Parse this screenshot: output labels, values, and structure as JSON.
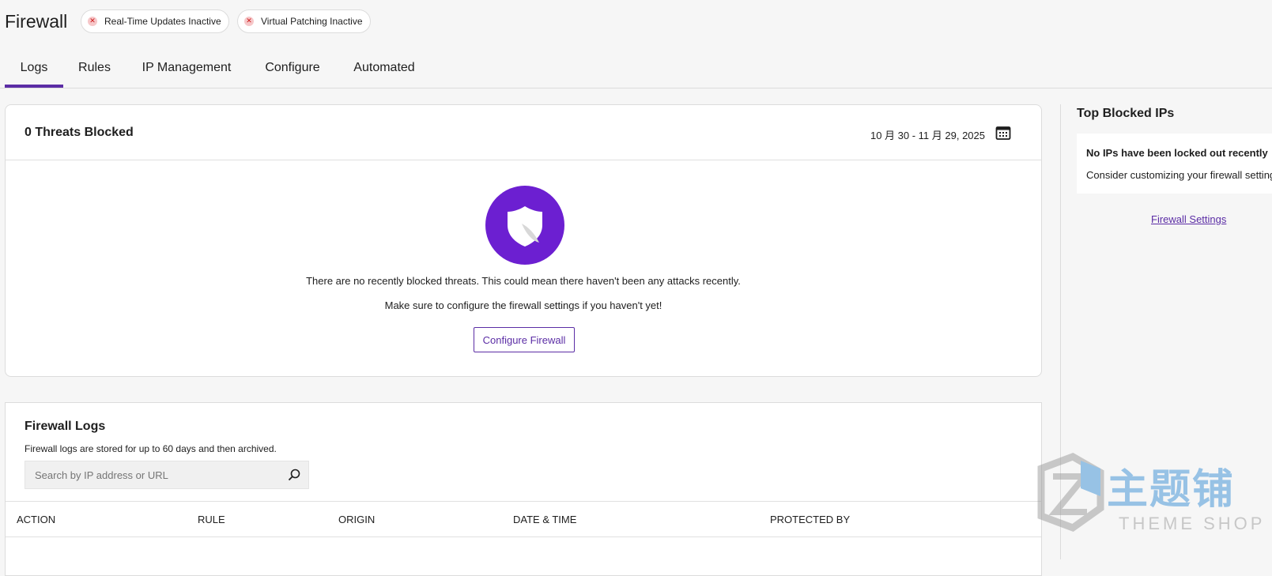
{
  "header": {
    "title": "Firewall",
    "badges": [
      {
        "label": "Real-Time Updates Inactive",
        "icon": "close-circle-icon"
      },
      {
        "label": "Virtual Patching Inactive",
        "icon": "close-circle-icon"
      }
    ]
  },
  "tabs": [
    {
      "label": "Logs",
      "active": true
    },
    {
      "label": "Rules",
      "active": false
    },
    {
      "label": "IP Management",
      "active": false
    },
    {
      "label": "Configure",
      "active": false
    },
    {
      "label": "Automated",
      "active": false
    }
  ],
  "threats_card": {
    "title": "0 Threats Blocked",
    "date_range": "10 月 30 - 11 月 29, 2025",
    "calendar_icon": "calendar-icon",
    "shield_icon": "shield-icon",
    "message_1": "There are no recently blocked threats. This could mean there haven't been any attacks recently.",
    "message_2": "Make sure to configure the firewall settings if you haven't yet!",
    "configure_button": "Configure Firewall"
  },
  "logs": {
    "title": "Firewall Logs",
    "subtitle": "Firewall logs are stored for up to 60 days and then archived.",
    "search_placeholder": "Search by IP address or URL",
    "search_value": "",
    "columns": [
      "Action",
      "Rule",
      "Origin",
      "Date & Time",
      "Protected By"
    ]
  },
  "sidebar": {
    "title": "Top Blocked IPs",
    "empty_title": "No IPs have been locked out recently",
    "empty_text": "Consider customizing your firewall settings",
    "link": "Firewall Settings"
  },
  "watermark": {
    "chinese": "主题铺",
    "english": "THEME SHOP"
  },
  "colors": {
    "accent": "#5b2da5",
    "shield_bg": "#6c1fd1",
    "inactive_badge_icon": "#cc1818",
    "watermark_blue": "#3a8fd6"
  }
}
